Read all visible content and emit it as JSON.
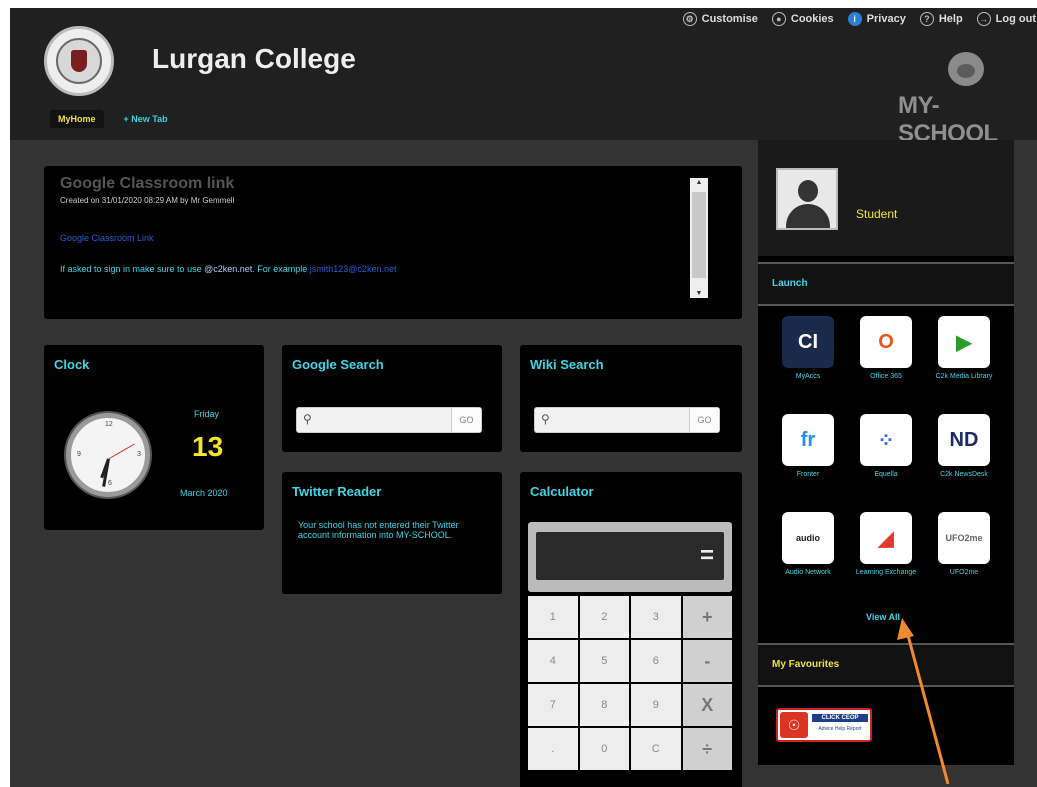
{
  "header": {
    "school_name": "Lurgan College",
    "logo_text": "MY-SCHOOL",
    "top_links": [
      {
        "label": "Customise",
        "icon": "gear-icon"
      },
      {
        "label": "Cookies",
        "icon": "cookie-icon"
      },
      {
        "label": "Privacy",
        "icon": "privacy-icon"
      },
      {
        "label": "Help",
        "icon": "help-icon"
      },
      {
        "label": "Log out",
        "icon": "logout-icon"
      }
    ],
    "tabs": [
      {
        "label": "MyHome"
      },
      {
        "label": "+ New Tab"
      }
    ]
  },
  "announcement": {
    "title": "Google Classroom link",
    "meta": "Created on 31/01/2020 08:29 AM by Mr Gemmell",
    "link": "Google Classroom Link",
    "text_before": "If asked to sign in make sure to use ",
    "domain": "@c2ken.net",
    "text_after": ". For example ",
    "email": "jsmith123@c2ken.net"
  },
  "clock": {
    "title": "Clock",
    "day": "Friday",
    "date": "13",
    "month": "March 2020"
  },
  "google_search": {
    "title": "Google Search",
    "go": "GO"
  },
  "wiki_search": {
    "title": "Wiki Search",
    "go": "GO"
  },
  "twitter": {
    "title": "Twitter Reader",
    "text": "Your school has not entered their Twitter account information into MY-SCHOOL."
  },
  "calculator": {
    "title": "Calculator",
    "equals": "=",
    "keys": [
      "1",
      "2",
      "3",
      "+",
      "4",
      "5",
      "6",
      "-",
      "7",
      "8",
      "9",
      "X",
      ".",
      "0",
      "C",
      "÷"
    ]
  },
  "sidebar": {
    "user_role": "Student",
    "launch_title": "Launch",
    "apps": [
      {
        "label": "MyAccs",
        "tile_text": "CI",
        "icon": "myaccs-icon",
        "bg": "#1a2a4a",
        "fg": "#ffffff"
      },
      {
        "label": "Office 365",
        "tile_text": "O",
        "icon": "office-365-icon",
        "bg": "#ffffff",
        "fg": "#e8541b"
      },
      {
        "label": "C2k Media Library",
        "tile_text": "▶",
        "icon": "media-library-icon",
        "bg": "#ffffff",
        "fg": "#2a9d2a"
      },
      {
        "label": "Fronter",
        "tile_text": "fr",
        "icon": "fronter-icon",
        "bg": "#ffffff",
        "fg": "#1e90ff"
      },
      {
        "label": "Equella",
        "tile_text": "⁘",
        "icon": "equella-icon",
        "bg": "#ffffff",
        "fg": "#2b6fd6"
      },
      {
        "label": "C2k NewsDesk",
        "tile_text": "ND",
        "icon": "newsdesk-icon",
        "bg": "#ffffff",
        "fg": "#1a2a6a"
      },
      {
        "label": "Audio Network",
        "tile_text": "audio",
        "icon": "audio-network-icon",
        "bg": "#ffffff",
        "fg": "#222222"
      },
      {
        "label": "Learning Exchange",
        "tile_text": "◢",
        "icon": "learning-exchange-icon",
        "bg": "#ffffff",
        "fg": "#e03a2a"
      },
      {
        "label": "UFO2me",
        "tile_text": "UFO2me",
        "icon": "ufo2me-icon",
        "bg": "#ffffff",
        "fg": "#666666"
      }
    ],
    "view_all": "View All",
    "favourites_title": "My Favourites",
    "favourite": {
      "title": "CLICK CEOP",
      "subtitle": "Advice Help Report"
    }
  }
}
